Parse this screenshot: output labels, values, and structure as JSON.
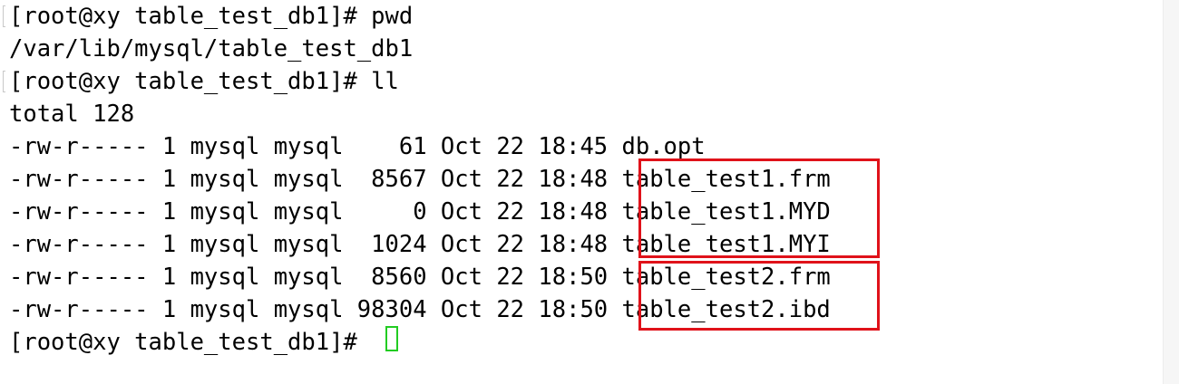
{
  "terminal": {
    "lines": [
      "[root@xy table_test_db1]# pwd",
      "/var/lib/mysql/table_test_db1",
      "[root@xy table_test_db1]# ll",
      "total 128",
      "-rw-r----- 1 mysql mysql    61 Oct 22 18:45 db.opt",
      "-rw-r----- 1 mysql mysql  8567 Oct 22 18:48 table_test1.frm",
      "-rw-r----- 1 mysql mysql     0 Oct 22 18:48 table_test1.MYD",
      "-rw-r----- 1 mysql mysql  1024 Oct 22 18:48 table_test1.MYI",
      "-rw-r----- 1 mysql mysql  8560 Oct 22 18:50 table_test2.frm",
      "-rw-r----- 1 mysql mysql 98304 Oct 22 18:50 table_test2.ibd",
      "[root@xy table_test_db1]# "
    ]
  },
  "colors": {
    "text": "#000000",
    "highlight_box": "#e0121a",
    "cursor": "#22cc22",
    "background": "#ffffff"
  }
}
